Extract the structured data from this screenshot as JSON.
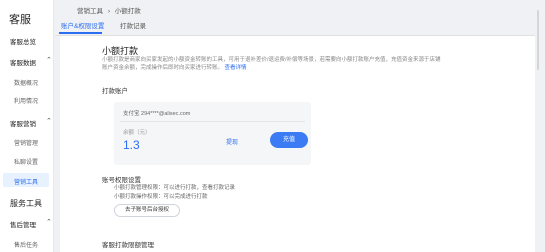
{
  "sidebar": {
    "title": "客服",
    "items": [
      {
        "label": "客服总览"
      },
      {
        "label": "客服数据"
      },
      {
        "label": "数据概况"
      },
      {
        "label": "利用情况"
      },
      {
        "label": "客服营销"
      },
      {
        "label": "营销管理"
      },
      {
        "label": "私聊设置"
      },
      {
        "label": "营销工具"
      },
      {
        "label": "服务工具"
      },
      {
        "label": "售后管理"
      },
      {
        "label": "售后任务"
      }
    ],
    "caret": "⌃"
  },
  "breadcrumb": {
    "parent": "营销工具",
    "separator": "›",
    "current": "小额打款"
  },
  "tabs": [
    {
      "label": "账户&权限设置"
    },
    {
      "label": "打款记录"
    }
  ],
  "section": {
    "title": "小额打款",
    "description": "小额打款是商家向买家发起的小额资金转账的工具，可用于退补差价/退运费/补偿等场景，若需要向小额打款账户充值，充值资金来源于店铺账户资金余额，完成操作后即时向买家进行转账。",
    "link_text": "查看详情"
  },
  "account": {
    "label": "打款账户",
    "account_text": "支付宝 294****@alisec.com",
    "balance_label": "余额（元）",
    "balance": "1.3",
    "withdraw_label": "提现",
    "recharge_label": "充值"
  },
  "permission": {
    "title": "账号权限设置",
    "line1": "小额打款管理权限：可以进行打款，查看打款记录",
    "line2": "小额打款操作权限：可以完成进行打款",
    "button_label": "去子账号后台授权"
  },
  "rules": {
    "title": "客服打款限额管理"
  }
}
